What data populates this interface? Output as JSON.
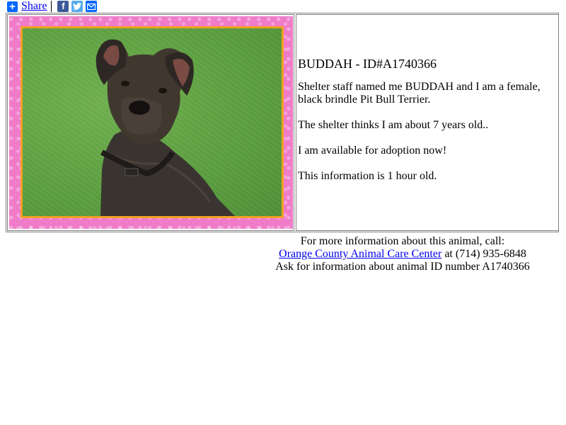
{
  "share": {
    "label": "Share",
    "icons": [
      "share-plus-icon",
      "facebook-icon",
      "twitter-icon",
      "email-icon"
    ],
    "colors": {
      "share": "#0166ff",
      "facebook": "#3b5998",
      "twitter": "#55acee"
    }
  },
  "animal": {
    "title": "BUDDAH - ID#A1740366",
    "description": "Shelter staff named me BUDDAH and I am a female, black brindle Pit Bull Terrier.",
    "age": "The shelter thinks I am about 7 years old..",
    "availability": "I am available for adoption now!",
    "freshness": "This information is 1 hour old."
  },
  "contact": {
    "line1": "For more information about this animal, call:",
    "shelter_link": "Orange County Animal Care Center",
    "phone_text": " at (714) 935-6848",
    "line3": "Ask for information about animal ID number A1740366"
  },
  "colors": {
    "frame_pink": "#f07cc9",
    "frame_orange": "#f2a023",
    "link": "#0000ee"
  }
}
